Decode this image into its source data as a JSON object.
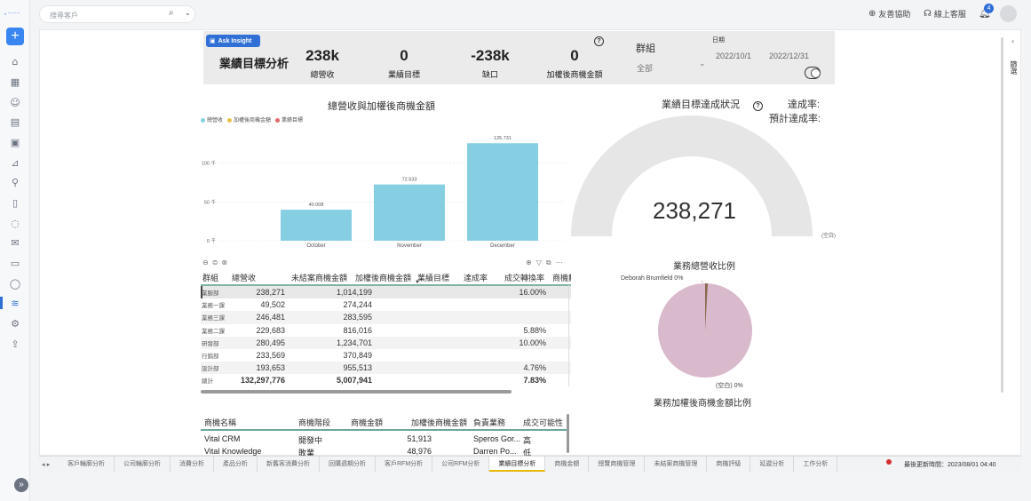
{
  "topbar": {
    "search_placeholder": "搜尋客戶",
    "links": [
      "友善協助",
      "線上客服"
    ],
    "notifications": "4"
  },
  "sidebar": {
    "logo": "🞄 ·······",
    "new_button": "+",
    "expand_button": "»",
    "icons": [
      "home-icon",
      "calendar-icon",
      "contacts-icon",
      "building-icon",
      "task-icon",
      "campaign-icon",
      "location-icon",
      "document-icon",
      "chat-icon",
      "mail-icon",
      "contract-icon",
      "comment-icon",
      "analytics-icon",
      "settings-icon",
      "export-icon"
    ]
  },
  "filters_tab": "篩選",
  "kpi": {
    "ask_insight": "Ask Insight",
    "title": "業績目標分析",
    "items": [
      {
        "value": "238k",
        "label": "總營收"
      },
      {
        "value": "0",
        "label": "業績目標"
      },
      {
        "value": "-238k",
        "label": "缺口"
      },
      {
        "value": "0",
        "label": "加權後商機金額"
      }
    ],
    "group_label": "群組",
    "group_value": "全部",
    "date_label": "日期",
    "date_from": "2022/10/1",
    "date_to": "2022/12/31"
  },
  "chart_data": {
    "type": "bar",
    "title": "總營收與加權後商機金額",
    "legend": [
      "總營收",
      "加權後商機金額",
      "業績目標"
    ],
    "legend_colors": [
      "#86cfe3",
      "#e6c24a",
      "#e06a6a"
    ],
    "categories": [
      "October",
      "November",
      "December"
    ],
    "series": [
      {
        "name": "總營收",
        "values": [
          40.008,
          72.533,
          125.731
        ]
      }
    ],
    "ytick_labels": [
      "100 千",
      "50 千",
      "0 千"
    ],
    "yticks": [
      100,
      50,
      0
    ],
    "ylim": [
      0,
      150
    ],
    "data_labels": [
      "40.008",
      "72.533",
      "125.731"
    ]
  },
  "table": {
    "headers": [
      "群組",
      "總營收",
      "未結案商機金額",
      "加權後商機金額",
      "業績目標",
      "達成率",
      "成交轉換率",
      "商機數"
    ],
    "rows": [
      {
        "group": "業服部",
        "revenue": "238,271",
        "open": "1,014,199",
        "conv": "16.00%"
      },
      {
        "group": "業務一課",
        "revenue": "49,502",
        "open": "274,244",
        "conv": ""
      },
      {
        "group": "業務三課",
        "revenue": "246,481",
        "open": "283,595",
        "conv": ""
      },
      {
        "group": "業務二課",
        "revenue": "229,683",
        "open": "816,016",
        "conv": "5.88%"
      },
      {
        "group": "研發部",
        "revenue": "280,495",
        "open": "1,234,701",
        "conv": "10.00%"
      },
      {
        "group": "行銷部",
        "revenue": "233,569",
        "open": "370,849",
        "conv": ""
      },
      {
        "group": "設計部",
        "revenue": "193,653",
        "open": "955,513",
        "conv": "4.76%"
      }
    ],
    "total": {
      "group": "總計",
      "revenue": "132,297,776",
      "open": "5,007,941",
      "conv": "7.83%"
    }
  },
  "gauge": {
    "title": "業績目標達成狀況",
    "value": "238,271",
    "max_label": "(空白)",
    "rate_label": "達成率:",
    "est_rate_label": "預計達成率:",
    "fill_fraction": 1.0
  },
  "pie": {
    "title": "業務總營收比例",
    "label_top": "Deborah Brumfield 0%",
    "label_bottom": "(空白) 0%",
    "subtitle": "業務加權後商機金額比例",
    "colors": [
      "#d9b9cc",
      "#8a6a50"
    ]
  },
  "opportunity_table": {
    "headers": [
      "商機名稱",
      "商機階段",
      "商機金額",
      "加權後商機金額",
      "負責業務",
      "成交可能性"
    ],
    "rows": [
      [
        "Vital CRM",
        "開發中",
        "51,913",
        "",
        "Speros Gor...",
        "高"
      ],
      [
        "Vital Knowledge",
        "敗業",
        "48,976",
        "",
        "Darren Po...",
        "低"
      ]
    ]
  },
  "tabs": [
    "客戶輪廓分析",
    "公司輪廓分析",
    "消費分析",
    "產品分析",
    "新舊客消費分析",
    "回購週期分析",
    "客戶RFM分析",
    "公司RFM分析",
    "業績目標分析",
    "商機金額",
    "總覽商機管理",
    "未結案商機管理",
    "商機評級",
    "延遲分析",
    "工作分析"
  ],
  "active_tab": "業績目標分析",
  "last_update": "最後更新時間：2023/08/01 04:40"
}
